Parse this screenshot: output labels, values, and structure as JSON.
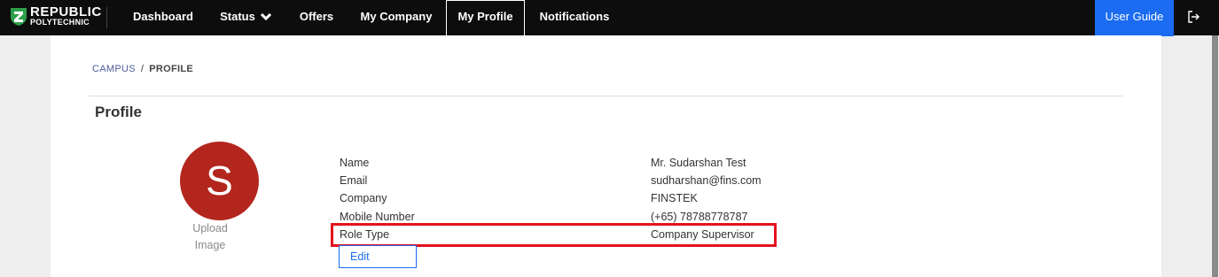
{
  "nav": {
    "logo_line1": "REPUBLIC",
    "logo_line2": "POLYTECHNIC",
    "items": [
      {
        "label": "Dashboard"
      },
      {
        "label": "Status"
      },
      {
        "label": "Offers"
      },
      {
        "label": "My Company"
      },
      {
        "label": "My Profile"
      },
      {
        "label": "Notifications"
      }
    ],
    "active_item": "My Profile",
    "user_guide_label": "User Guide",
    "logout_icon": "logout-icon"
  },
  "breadcrumb": {
    "items": [
      "CAMPUS",
      "PROFILE"
    ],
    "separator": "/"
  },
  "page_title": "Profile",
  "avatar": {
    "initial": "S",
    "upload_label": "Upload Image"
  },
  "profile": {
    "rows": [
      {
        "label": "Name",
        "value": "Mr. Sudarshan Test"
      },
      {
        "label": "Email",
        "value": "sudharshan@fins.com"
      },
      {
        "label": "Company",
        "value": "FINSTEK"
      },
      {
        "label": "Mobile Number",
        "value": "(+65) 78788778787"
      },
      {
        "label": "Role Type",
        "value": "Company Supervisor"
      }
    ],
    "edit_label": "Edit"
  },
  "colors": {
    "navbar": "#0d0d0d",
    "accent": "#1b6cf2",
    "avatar": "#b3261e",
    "highlight": "#e3121e"
  }
}
